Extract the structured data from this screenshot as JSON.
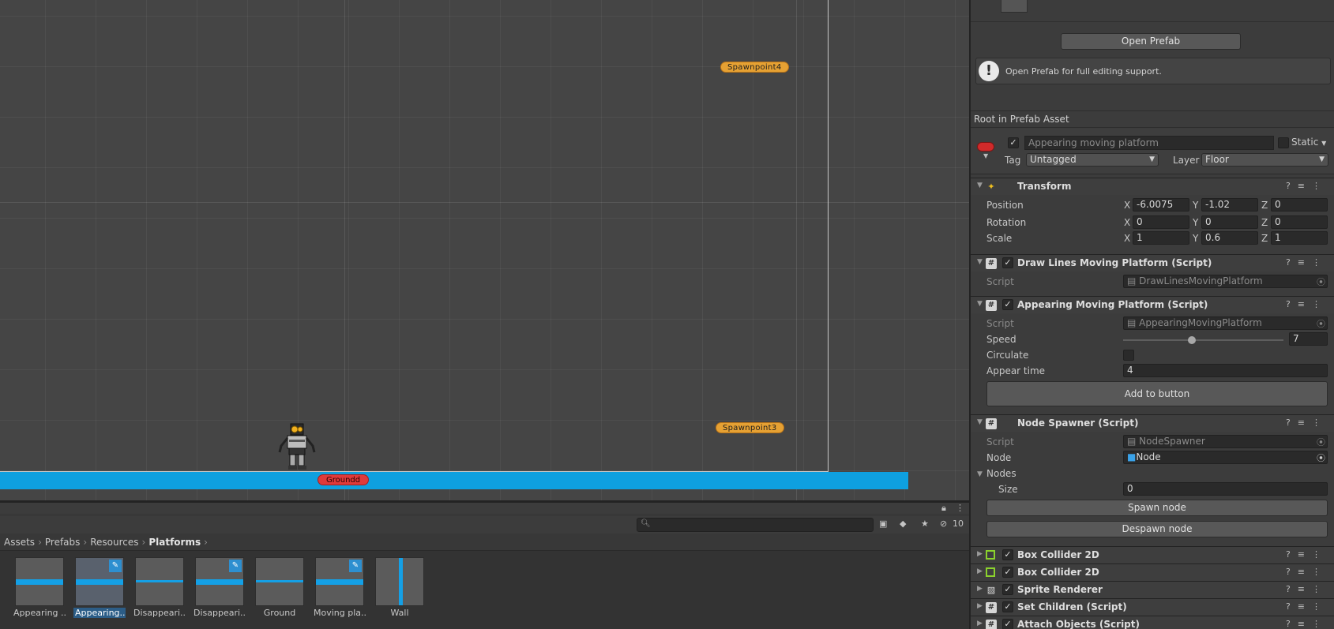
{
  "scene": {
    "spawnpoint4": "Spawnpoint4",
    "spawnpoint3": "Spawnpoint3",
    "ground": "Groundd"
  },
  "project": {
    "badge_count": "10",
    "search_placeholder": "",
    "breadcrumb": [
      "Assets",
      "Prefabs",
      "Resources",
      "Platforms"
    ],
    "assets": [
      {
        "name": "Appearing ...",
        "thumb": "hbar",
        "edit": false,
        "selected": false
      },
      {
        "name": "Appearing...",
        "thumb": "hbar",
        "edit": true,
        "selected": true
      },
      {
        "name": "Disappeari...",
        "thumb": "thinbar",
        "edit": false,
        "selected": false
      },
      {
        "name": "Disappeari...",
        "thumb": "hbar",
        "edit": true,
        "selected": false
      },
      {
        "name": "Ground",
        "thumb": "thinbar",
        "edit": false,
        "selected": false
      },
      {
        "name": "Moving pla...",
        "thumb": "hbar",
        "edit": true,
        "selected": false
      },
      {
        "name": "Wall",
        "thumb": "vbar",
        "edit": false,
        "selected": false
      }
    ]
  },
  "inspector": {
    "open_prefab": "Open Prefab",
    "help_text": "Open Prefab for full editing support.",
    "root_label": "Root in Prefab Asset",
    "go_name": "Appearing moving platform",
    "static_label": "Static",
    "tag_label": "Tag",
    "tag_value": "Untagged",
    "layer_label": "Layer",
    "layer_value": "Floor",
    "transform": {
      "title": "Transform",
      "position_label": "Position",
      "rotation_label": "Rotation",
      "scale_label": "Scale",
      "position": {
        "x": "-6.0075",
        "y": "-1.02",
        "z": "0"
      },
      "rotation": {
        "x": "0",
        "y": "0",
        "z": "0"
      },
      "scale": {
        "x": "1",
        "y": "0.6",
        "z": "1"
      }
    },
    "draw_lines": {
      "title": "Draw Lines Moving Platform (Script)",
      "script_label": "Script",
      "script_value": "DrawLinesMovingPlatform"
    },
    "appearing": {
      "title": "Appearing Moving Platform (Script)",
      "script_label": "Script",
      "script_value": "AppearingMovingPlatform",
      "speed_label": "Speed",
      "speed_value": "7",
      "speed_fraction": 0.43,
      "circulate_label": "Circulate",
      "appear_label": "Appear time",
      "appear_value": "4",
      "add_button": "Add to button"
    },
    "node_spawner": {
      "title": "Node Spawner (Script)",
      "script_label": "Script",
      "script_value": "NodeSpawner",
      "node_label": "Node",
      "node_value": "Node",
      "nodes_label": "Nodes",
      "size_label": "Size",
      "size_value": "0",
      "spawn_button": "Spawn node",
      "despawn_button": "Despawn node"
    },
    "components": [
      {
        "title": "Box Collider 2D",
        "icon": "collider"
      },
      {
        "title": "Box Collider 2D",
        "icon": "collider"
      },
      {
        "title": "Sprite Renderer",
        "icon": "sprite"
      },
      {
        "title": "Set Children (Script)",
        "icon": "script"
      },
      {
        "title": "Attach Objects (Script)",
        "icon": "script"
      }
    ]
  },
  "axis_labels": {
    "x": "X",
    "y": "Y",
    "z": "Z"
  },
  "colors": {
    "accent_blue": "#0ea0e0",
    "spawn_orange": "#e6a133",
    "ground_red": "#e03a3a"
  }
}
